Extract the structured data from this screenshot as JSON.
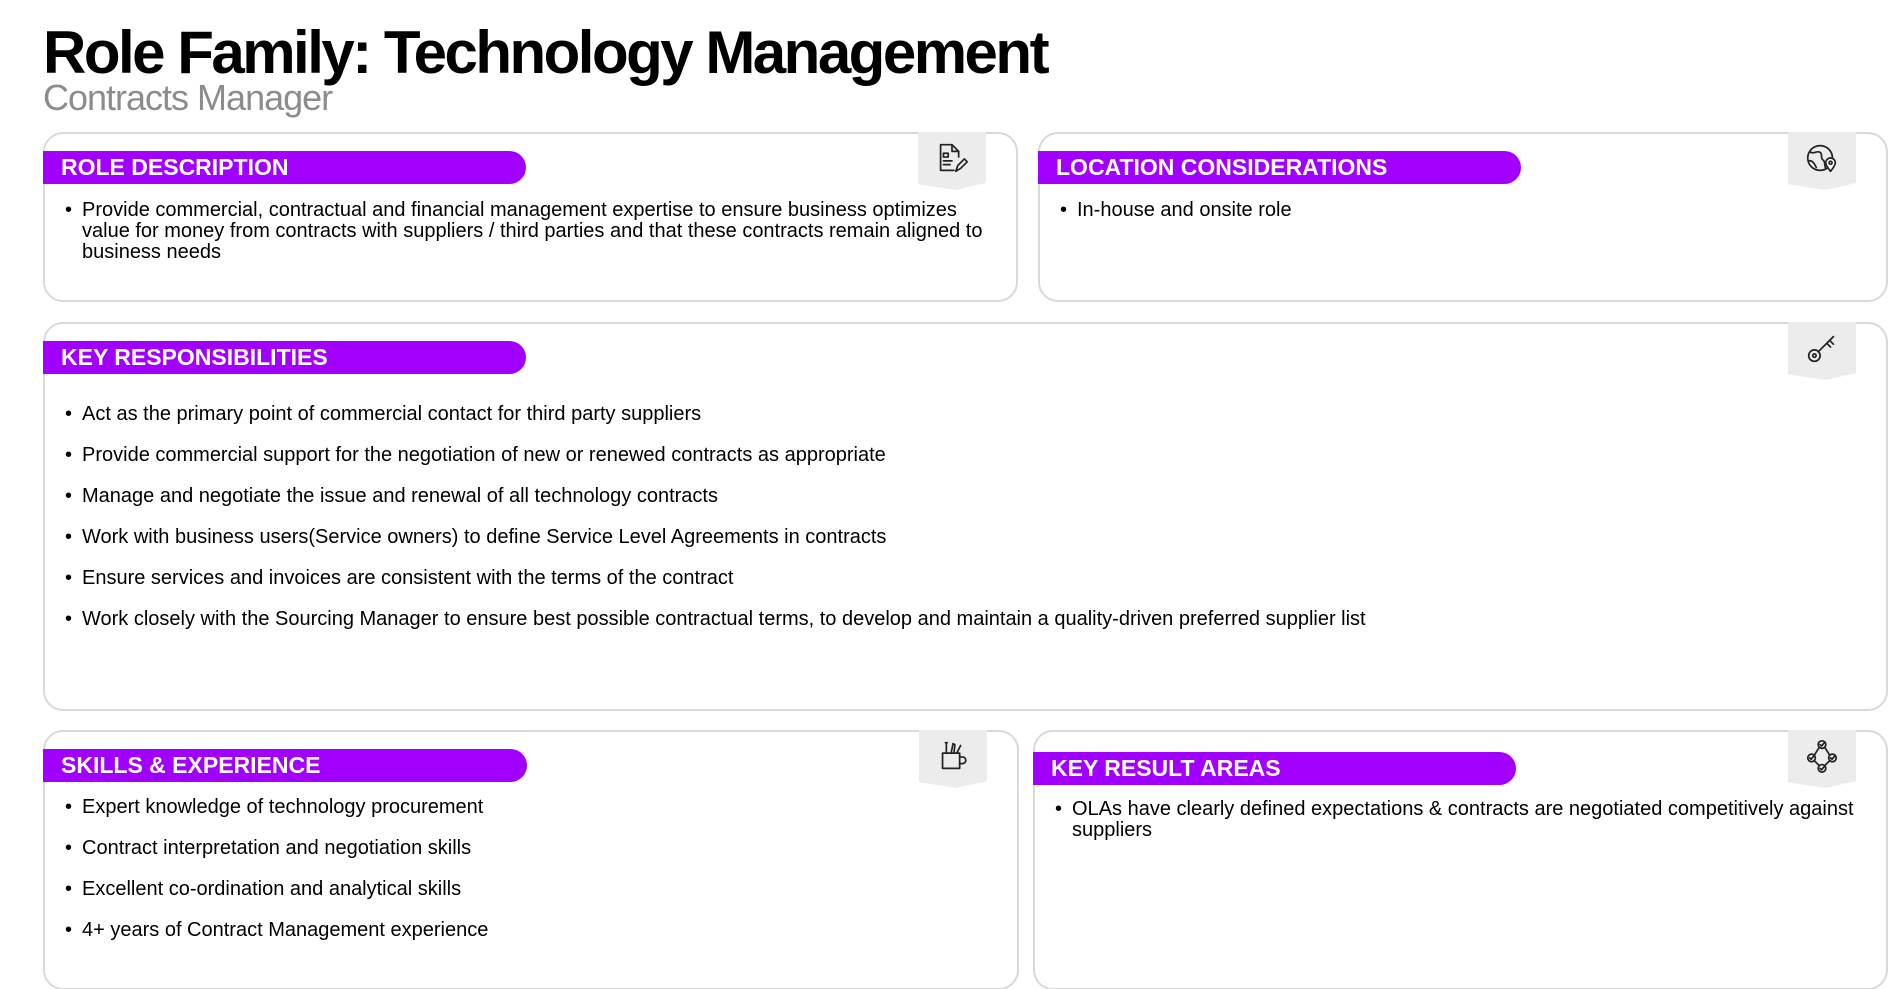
{
  "header": {
    "title": "Role Family: Technology Management",
    "subtitle": "Contracts Manager"
  },
  "colors": {
    "accent": "#a100ff",
    "card_border": "#d9d9d9",
    "icon_tab": "#ececec",
    "subtitle": "#8c8c8c"
  },
  "role_description": {
    "heading": "ROLE DESCRIPTION",
    "icon": "document-pen-icon",
    "items": [
      "Provide commercial, contractual and financial management expertise to ensure business optimizes value for money from contracts with suppliers / third parties and that these contracts remain aligned to business needs"
    ]
  },
  "location": {
    "heading": "LOCATION CONSIDERATIONS",
    "icon": "globe-pin-icon",
    "items": [
      "In-house and onsite role"
    ]
  },
  "responsibilities": {
    "heading": "KEY RESPONSIBILITIES",
    "icon": "key-icon",
    "items": [
      "Act as the primary point of commercial contact for third party suppliers",
      "Provide commercial support for the negotiation of new or renewed contracts as appropriate",
      "Manage and negotiate the issue and renewal of all technology contracts",
      "Work with business users(Service owners) to define Service Level Agreements in contracts",
      "Ensure services and invoices are consistent with the terms of the contract",
      "Work closely with the Sourcing Manager to ensure best possible contractual terms, to develop and maintain a quality-driven preferred supplier list"
    ]
  },
  "skills": {
    "heading": "SKILLS & EXPERIENCE",
    "icon": "tool-cup-icon",
    "items": [
      "Expert knowledge of technology procurement",
      "Contract interpretation and negotiation skills",
      "Excellent co-ordination and analytical skills",
      "4+ years of Contract Management experience"
    ]
  },
  "kra": {
    "heading": "KEY RESULT AREAS",
    "icon": "checkmark-network-icon",
    "items": [
      "OLAs have clearly defined expectations & contracts are negotiated competitively against suppliers"
    ]
  }
}
